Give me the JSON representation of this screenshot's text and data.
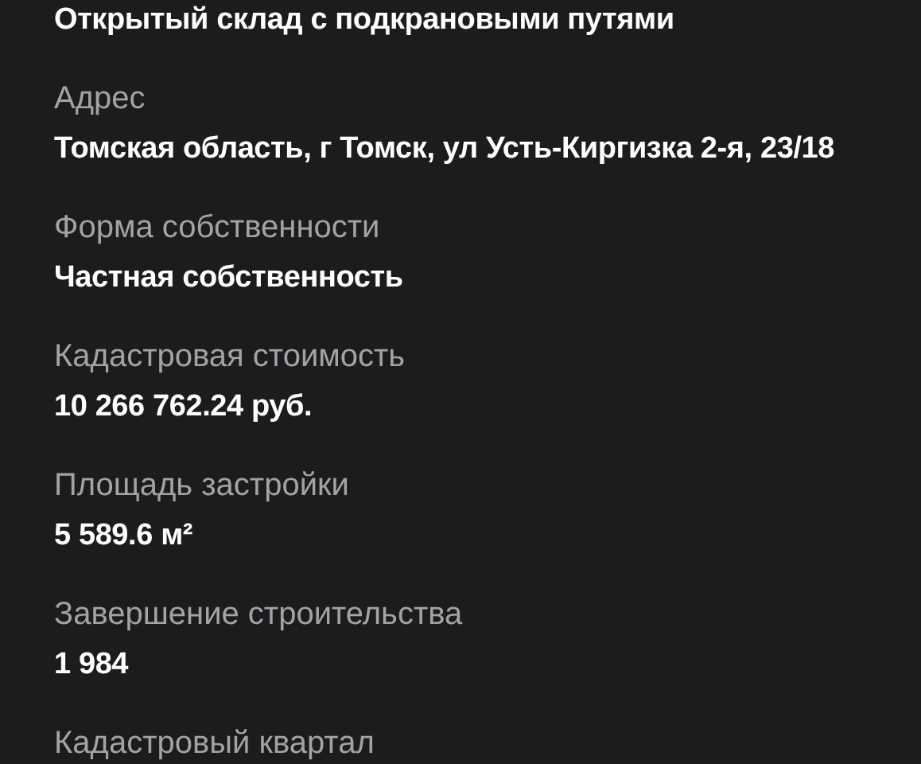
{
  "fields": [
    {
      "value": "Открытый склад с подкрановыми путями"
    },
    {
      "label": "Адрес",
      "value": "Томская область, г Томск, ул Усть-Киргизка 2-я, 23/18"
    },
    {
      "label": "Форма собственности",
      "value": "Частная собственность"
    },
    {
      "label": "Кадастровая стоимость",
      "value": "10 266 762.24 руб."
    },
    {
      "label": "Площадь застройки",
      "value": "5 589.6 м²"
    },
    {
      "label": "Завершение строительства",
      "value": "1 984"
    },
    {
      "label": "Кадастровый квартал"
    }
  ]
}
